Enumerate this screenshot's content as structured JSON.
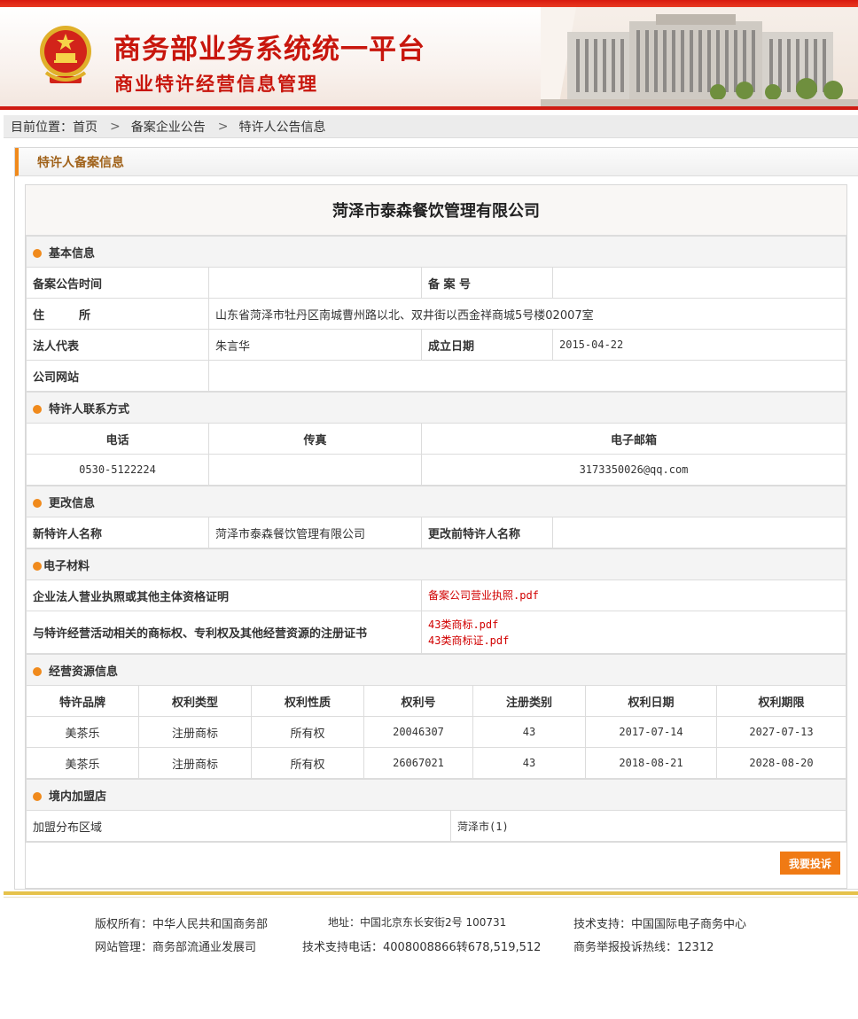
{
  "header": {
    "title": "商务部业务系统统一平台",
    "subtitle": "商业特许经营信息管理"
  },
  "breadcrumb": {
    "label": "目前位置：",
    "items": [
      "首页",
      "备案企业公告",
      "特许人公告信息"
    ],
    "separator": ">"
  },
  "panel": {
    "title": "特许人备案信息",
    "company_name": "菏泽市泰森餐饮管理有限公司"
  },
  "basic": {
    "section": "基本信息",
    "announce_time_label": "备案公告时间",
    "announce_time": "",
    "record_no_label": "备 案 号",
    "record_no": "",
    "address_label": "住　　　所",
    "address": "山东省菏泽市牡丹区南城曹州路以北、双井街以西金祥商城5号楼02007室",
    "legal_rep_label": "法人代表",
    "legal_rep": "朱言华",
    "found_date_label": "成立日期",
    "found_date": "2015-04-22",
    "website_label": "公司网站",
    "website": ""
  },
  "contact": {
    "section": "特许人联系方式",
    "headers": [
      "电话",
      "传真",
      "电子邮箱"
    ],
    "phone": "0530-5122224",
    "fax": "",
    "email": "3173350026@qq.com"
  },
  "change": {
    "section": "更改信息",
    "new_name_label": "新特许人名称",
    "new_name": "菏泽市泰森餐饮管理有限公司",
    "old_name_label": "更改前特许人名称",
    "old_name": ""
  },
  "materials": {
    "section": "电子材料",
    "license_label": "企业法人营业执照或其他主体资格证明",
    "license_files": [
      "备案公司营业执照.pdf"
    ],
    "trademark_label": "与特许经营活动相关的商标权、专利权及其他经营资源的注册证书",
    "trademark_files": [
      "43类商标.pdf",
      "43类商标证.pdf"
    ]
  },
  "resources": {
    "section": "经营资源信息",
    "headers": [
      "特许品牌",
      "权利类型",
      "权利性质",
      "权利号",
      "注册类别",
      "权利日期",
      "权利期限"
    ],
    "rows": [
      [
        "美茶乐",
        "注册商标",
        "所有权",
        "20046307",
        "43",
        "2017-07-14",
        "2027-07-13"
      ],
      [
        "美茶乐",
        "注册商标",
        "所有权",
        "26067021",
        "43",
        "2018-08-21",
        "2028-08-20"
      ]
    ]
  },
  "stores": {
    "section": "境内加盟店",
    "area_label": "加盟分布区域",
    "area_value": "菏泽市(1)"
  },
  "complain_button": "我要投诉",
  "footer": {
    "copyright": "版权所有：中华人民共和国商务部",
    "address": "地址：中国北京东长安街2号 100731",
    "tech_support": "技术支持：中国国际电子商务中心",
    "site_admin": "网站管理：商务部流通业发展司",
    "tech_phone": "技术支持电话：4008008866转678,519,512",
    "hotline": "商务举报投诉热线：12312"
  },
  "colors": {
    "brand_red": "#c8160d",
    "accent_orange": "#f08a1c",
    "link_red": "#d10000",
    "footer_gold": "#e6c24a"
  }
}
